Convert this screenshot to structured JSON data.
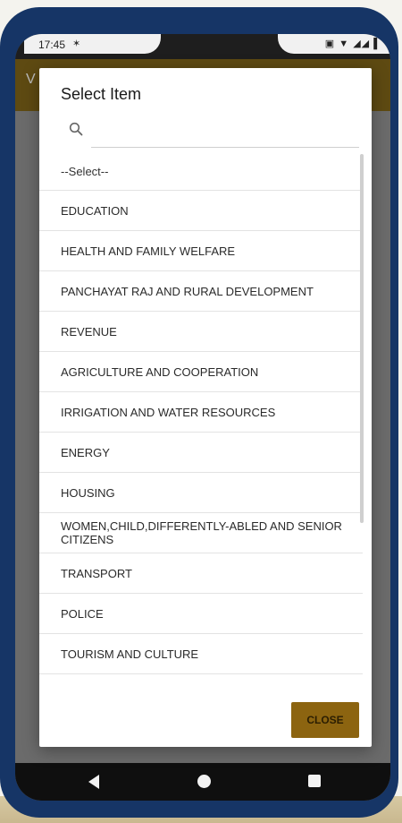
{
  "status_bar": {
    "time": "17:45",
    "icons": [
      "usb-debug-icon",
      "wifi-icon",
      "signal-icon",
      "battery-icon"
    ]
  },
  "appbar": {
    "partial_title": "V"
  },
  "dialog": {
    "title": "Select Item",
    "search_placeholder": "",
    "items": [
      "--Select--",
      "EDUCATION",
      "HEALTH AND FAMILY WELFARE",
      "PANCHAYAT RAJ AND RURAL DEVELOPMENT",
      "REVENUE",
      "AGRICULTURE AND COOPERATION",
      "IRRIGATION AND WATER RESOURCES",
      "ENERGY",
      "HOUSING",
      "WOMEN,CHILD,DIFFERENTLY-ABLED AND SENIOR CITIZENS",
      "TRANSPORT",
      "POLICE",
      "TOURISM AND CULTURE"
    ],
    "close_label": "CLOSE"
  },
  "colors": {
    "frame": "#163566",
    "appbar": "#5e4a12",
    "close_button": "#8c6410"
  }
}
